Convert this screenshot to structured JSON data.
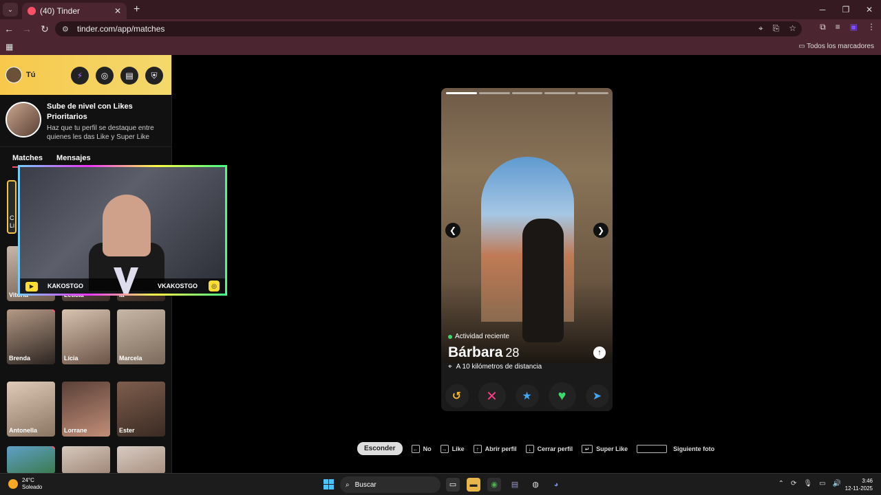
{
  "browser": {
    "tab_title": "(40) Tinder",
    "url": "tinder.com/app/matches",
    "bookmarks_label": "Todos los marcadores"
  },
  "sidebar": {
    "user_label": "Tú",
    "promo_title": "Sube de nivel con Likes Prioritarios",
    "promo_subtitle": "Haz que tu perfil se destaque entre quienes les das Like y Super Like",
    "tabs": [
      "Matches",
      "Mensajes"
    ],
    "matches": [
      {
        "name": "Vitória"
      },
      {
        "name": "Leticia"
      },
      {
        "name": "ia"
      },
      {
        "name": "Brenda"
      },
      {
        "name": "Lícia"
      },
      {
        "name": "Marcela"
      },
      {
        "name": "Antonella"
      },
      {
        "name": "Lorrane"
      },
      {
        "name": "Ester"
      }
    ],
    "partial_card_text": "C\nLi"
  },
  "stream_overlay": {
    "left_handle": "KAKOSTGO",
    "right_handle": "VKAKOSTGO"
  },
  "profile": {
    "activity": "Actividad reciente",
    "name": "Bárbara",
    "age": "28",
    "distance": "A 10 kilómetros de distancia",
    "photo_count": 5,
    "current_photo": 1
  },
  "shortcuts": {
    "hide_button": "Esconder",
    "no": "No",
    "like": "Like",
    "open_profile": "Abrir perfil",
    "close_profile": "Cerrar perfil",
    "super_like": "Super Like",
    "next_photo": "Siguiente foto"
  },
  "taskbar": {
    "temp": "24°C",
    "weather": "Soleado",
    "search_placeholder": "Buscar",
    "time": "3:46",
    "date": "12-11-2025"
  },
  "colors": {
    "tinder_pink": "#fd5068",
    "nope": "#ff3b8a",
    "like": "#3dd66d",
    "star": "#3ea4ff",
    "rewind": "#f5b82e",
    "boost": "#3ea4ff"
  }
}
